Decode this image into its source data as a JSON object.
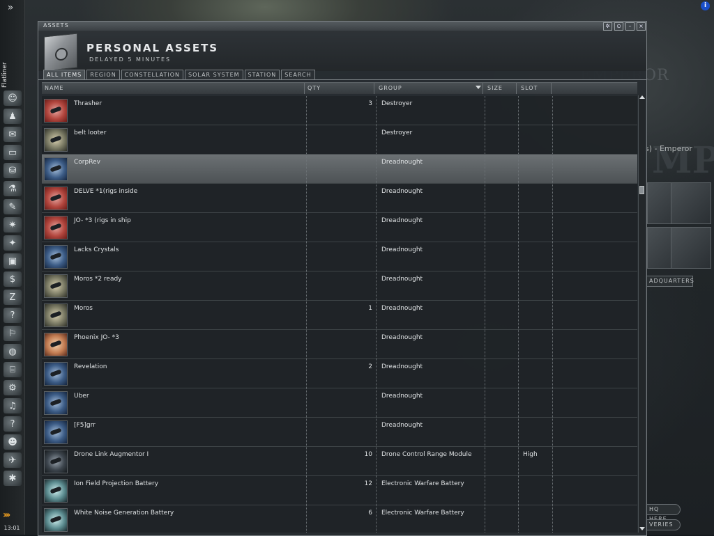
{
  "neocom": {
    "character_name": "Flatliner",
    "expand_glyph": "»",
    "clock": "13:01",
    "buttons": [
      "character-sheet",
      "people-places",
      "mail",
      "notepad",
      "market",
      "science",
      "journal",
      "map",
      "fitting",
      "assets",
      "wallet",
      "corporation",
      "help",
      "contracts",
      "planets",
      "browser",
      "factory",
      "headset",
      "help-question",
      "portrait",
      "ships",
      "items"
    ]
  },
  "background": {
    "corp_text": "EMPEROR",
    "large_text": "MP",
    "line_text": "s) - Emperor",
    "tab_label": "ADQUARTERS",
    "btn_hq": "HQ HERE",
    "btn_deliveries": "VERIES",
    "info_glyph": "i"
  },
  "window": {
    "caption": "ASSETS",
    "title": "PERSONAL ASSETS",
    "subtitle": "DELAYED 5 MINUTES",
    "controls": [
      "settings",
      "pin",
      "minimize",
      "close"
    ],
    "tabs": [
      {
        "label": "ALL ITEMS",
        "active": true
      },
      {
        "label": "REGION",
        "active": false
      },
      {
        "label": "CONSTELLATION",
        "active": false
      },
      {
        "label": "SOLAR SYSTEM",
        "active": false
      },
      {
        "label": "STATION",
        "active": false
      },
      {
        "label": "SEARCH",
        "active": false
      }
    ],
    "columns": {
      "name": "NAME",
      "qty": "QTY",
      "group": "GROUP",
      "size": "SIZE",
      "slot": "SLOT"
    },
    "rows": [
      {
        "name": "Thrasher",
        "qty": "3",
        "group": "Destroyer",
        "slot": "",
        "icon": "red",
        "selected": false
      },
      {
        "name": "belt looter",
        "qty": "",
        "group": "Destroyer",
        "slot": "",
        "icon": "tan",
        "selected": false
      },
      {
        "name": "CorpRev",
        "qty": "",
        "group": "Dreadnought",
        "slot": "",
        "icon": "blue",
        "selected": true
      },
      {
        "name": "DELVE *1(rigs inside",
        "qty": "",
        "group": "Dreadnought",
        "slot": "",
        "icon": "red",
        "selected": false
      },
      {
        "name": "JO- *3 (rigs in ship",
        "qty": "",
        "group": "Dreadnought",
        "slot": "",
        "icon": "red",
        "selected": false
      },
      {
        "name": "Lacks Crystals",
        "qty": "",
        "group": "Dreadnought",
        "slot": "",
        "icon": "blue",
        "selected": false
      },
      {
        "name": "Moros *2 ready",
        "qty": "",
        "group": "Dreadnought",
        "slot": "",
        "icon": "tan",
        "selected": false
      },
      {
        "name": "Moros",
        "qty": "1",
        "group": "Dreadnought",
        "slot": "",
        "icon": "tan",
        "selected": false
      },
      {
        "name": "Phoenix JO- *3",
        "qty": "",
        "group": "Dreadnought",
        "slot": "",
        "icon": "orange",
        "selected": false
      },
      {
        "name": "Revelation",
        "qty": "2",
        "group": "Dreadnought",
        "slot": "",
        "icon": "blue",
        "selected": false
      },
      {
        "name": "Uber",
        "qty": "",
        "group": "Dreadnought",
        "slot": "",
        "icon": "blue",
        "selected": false
      },
      {
        "name": "[F5]grr",
        "qty": "",
        "group": "Dreadnought",
        "slot": "",
        "icon": "blue",
        "selected": false
      },
      {
        "name": "Drone Link Augmentor I",
        "qty": "10",
        "group": "Drone Control Range Module",
        "slot": "High",
        "icon": "dark",
        "selected": false
      },
      {
        "name": "Ion Field Projection Battery",
        "qty": "12",
        "group": "Electronic Warfare Battery",
        "slot": "",
        "icon": "teal",
        "selected": false
      },
      {
        "name": "White Noise Generation Battery",
        "qty": "6",
        "group": "Electronic Warfare Battery",
        "slot": "",
        "icon": "teal",
        "selected": false
      }
    ]
  }
}
